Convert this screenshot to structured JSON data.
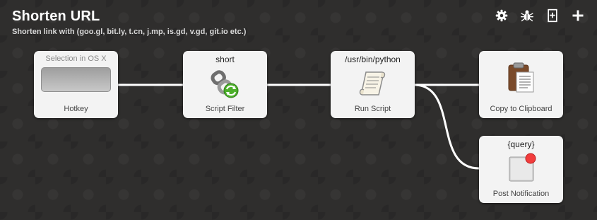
{
  "workflow": {
    "title": "Shorten URL",
    "subtitle": "Shorten link with (goo.gl, bit.ly, t.cn, j.mp, is.gd, v.gd, git.io etc.)"
  },
  "toolbar": {
    "icons": [
      "gear-icon",
      "bug-icon",
      "export-icon",
      "plus-icon"
    ]
  },
  "nodes": {
    "hotkey": {
      "top": "Selection in OS X",
      "label": "Hotkey"
    },
    "script_filter": {
      "top": "short",
      "label": "Script Filter"
    },
    "run_script": {
      "top": "/usr/bin/python",
      "label": "Run Script"
    },
    "clipboard": {
      "top": "",
      "label": "Copy to Clipboard"
    },
    "notification": {
      "top": "{query}",
      "label": "Post Notification"
    }
  },
  "colors": {
    "background": "#2f2e2d",
    "connection": "#ffffff",
    "node": "#f3f3f3"
  }
}
